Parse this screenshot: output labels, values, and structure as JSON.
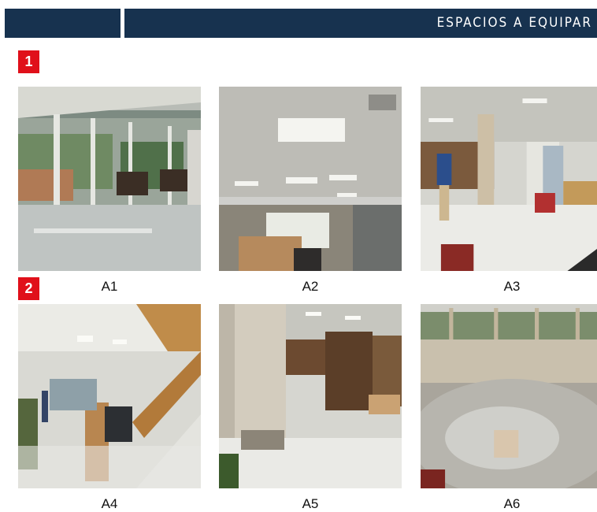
{
  "header": {
    "title": "ESPACIOS A EQUIPAR"
  },
  "sections": [
    {
      "number": "1"
    },
    {
      "number": "2"
    }
  ],
  "photos": [
    {
      "caption": "A1",
      "scene": "glass-wall-cafeteria"
    },
    {
      "caption": "A2",
      "scene": "library-hall-ceiling-lights"
    },
    {
      "caption": "A3",
      "scene": "bookshelves-with-person"
    },
    {
      "caption": "A4",
      "scene": "staircase-and-lobby"
    },
    {
      "caption": "A5",
      "scene": "column-and-bookshelves"
    },
    {
      "caption": "A6",
      "scene": "empty-round-room"
    }
  ]
}
